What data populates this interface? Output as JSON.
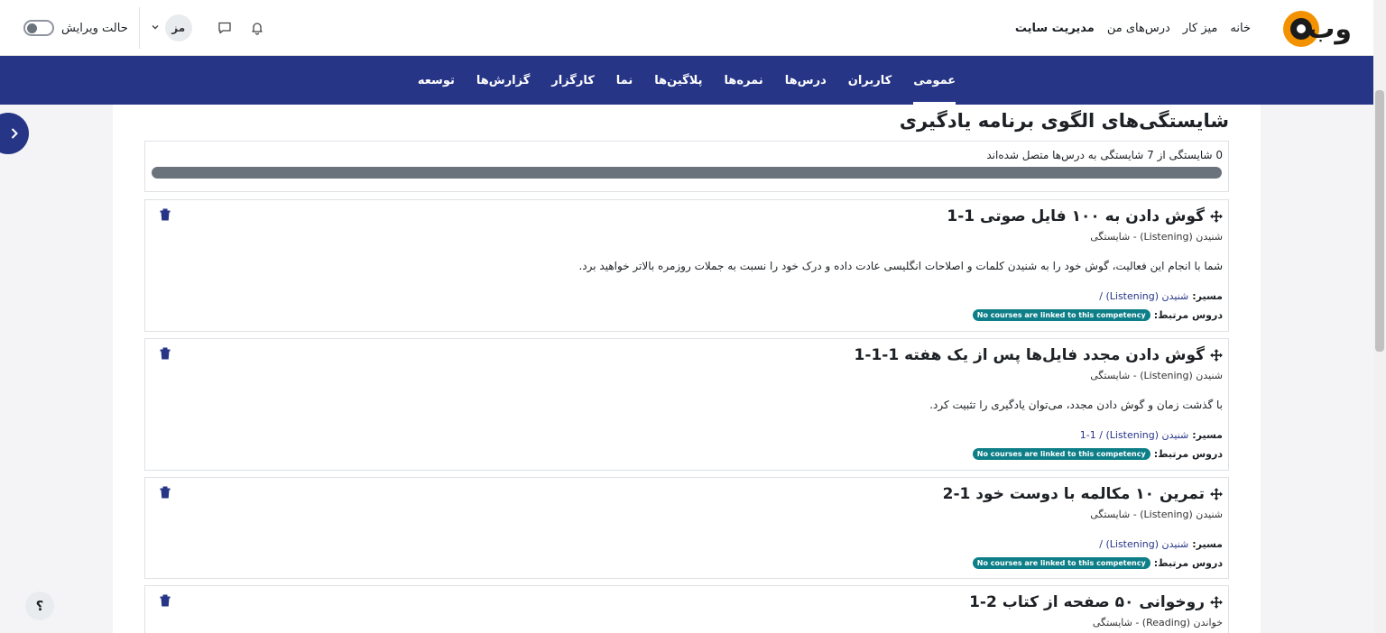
{
  "header": {
    "logo_text": "وب",
    "nav": [
      {
        "label": "خانه"
      },
      {
        "label": "میز کار"
      },
      {
        "label": "درس‌های من"
      },
      {
        "label": "مدیریت سایت"
      }
    ],
    "edit_mode_label": "حالت ویرایش",
    "user_initials": "مز"
  },
  "secondary_nav": {
    "items": [
      {
        "label": "عمومی"
      },
      {
        "label": "کاربران"
      },
      {
        "label": "درس‌ها"
      },
      {
        "label": "نمره‌ها"
      },
      {
        "label": "پلاگین‌ها"
      },
      {
        "label": "نما"
      },
      {
        "label": "کارگزار"
      },
      {
        "label": "گزارش‌ها"
      },
      {
        "label": "توسعه"
      }
    ]
  },
  "page": {
    "title": "شایستگی‌های الگوی برنامه یادگیری",
    "summary": "0 شایستگی از 7 شایستگی به درس‌ها متصل شده‌اند"
  },
  "labels": {
    "path": "مسیر:",
    "linked_courses": "دروس مرتبط:",
    "no_courses": "No courses are linked to this competency"
  },
  "competencies": [
    {
      "title": "گوش دادن به ۱۰۰ فایل صوتی 1-1",
      "subtitle": "شنیدن (Listening) - شایستگی",
      "description": "شما با انجام این فعالیت، گوش خود را به شنیدن کلمات و اصلاحات انگلیسی عادت داده و درک خود را نسبت به جملات روزمره بالاتر خواهید برد.",
      "path": "شنیدن (Listening) /"
    },
    {
      "title": "گوش دادن مجدد فایل‌ها پس از یک هفته 1-1-1",
      "subtitle": "شنیدن (Listening) - شایستگی",
      "description": "با گذشت زمان و گوش دادن مجدد، می‌توان یادگیری را تثبیت کرد.",
      "path": "شنیدن (Listening) / 1-1"
    },
    {
      "title": "تمرین ۱۰ مکالمه با دوست خود 1-2",
      "subtitle": "شنیدن (Listening) - شایستگی",
      "description": "",
      "path": "شنیدن (Listening) /"
    },
    {
      "title": "روخوانی ۵۰ صفحه از کتاب 2-1",
      "subtitle": "خواندن (Reading) - شایستگی",
      "description": "",
      "path": ""
    }
  ],
  "help_label": "؟",
  "colors": {
    "primary": "#273587",
    "badge": "#0e7f88",
    "progress": "#6a737b"
  }
}
